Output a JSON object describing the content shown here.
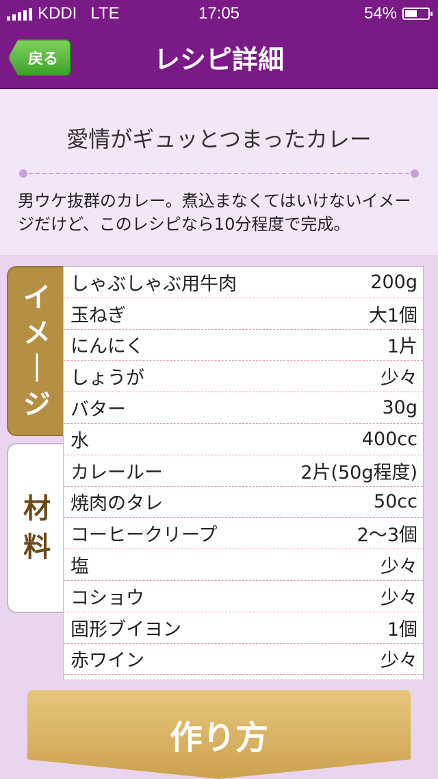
{
  "status_bar": {
    "carrier": "KDDI",
    "network": "LTE",
    "time": "17:05",
    "battery": "54%",
    "battery_level": 0.54
  },
  "nav": {
    "back_label": "戻る",
    "title": "レシピ詳細"
  },
  "recipe": {
    "title": "愛情がギュッとつまったカレー",
    "description": "男ウケ抜群のカレー。煮込まなくてはいけないイメージだけど、このレシピなら10分程度で完成。"
  },
  "tabs": {
    "image": "イメージ",
    "ingredients": "材料"
  },
  "ingredients": [
    {
      "name": "しゃぶしゃぶ用牛肉",
      "amount": "200g"
    },
    {
      "name": "玉ねぎ",
      "amount": "大1個"
    },
    {
      "name": "にんにく",
      "amount": "1片"
    },
    {
      "name": "しょうが",
      "amount": "少々"
    },
    {
      "name": "バター",
      "amount": "30g"
    },
    {
      "name": "水",
      "amount": "400cc"
    },
    {
      "name": "カレールー",
      "amount": "2片(50g程度)"
    },
    {
      "name": "焼肉のタレ",
      "amount": "50cc"
    },
    {
      "name": "コーヒークリープ",
      "amount": "2〜3個"
    },
    {
      "name": "塩",
      "amount": "少々"
    },
    {
      "name": "コショウ",
      "amount": "少々"
    },
    {
      "name": "固形ブイヨン",
      "amount": "1個"
    },
    {
      "name": "赤ワイン",
      "amount": "少々"
    }
  ],
  "actions": {
    "howto_label": "作り方"
  },
  "colors": {
    "header": "#7a1a86",
    "background": "#f3e6f6",
    "back_button": "#4cb336",
    "accent_gold": "#b48f44"
  }
}
